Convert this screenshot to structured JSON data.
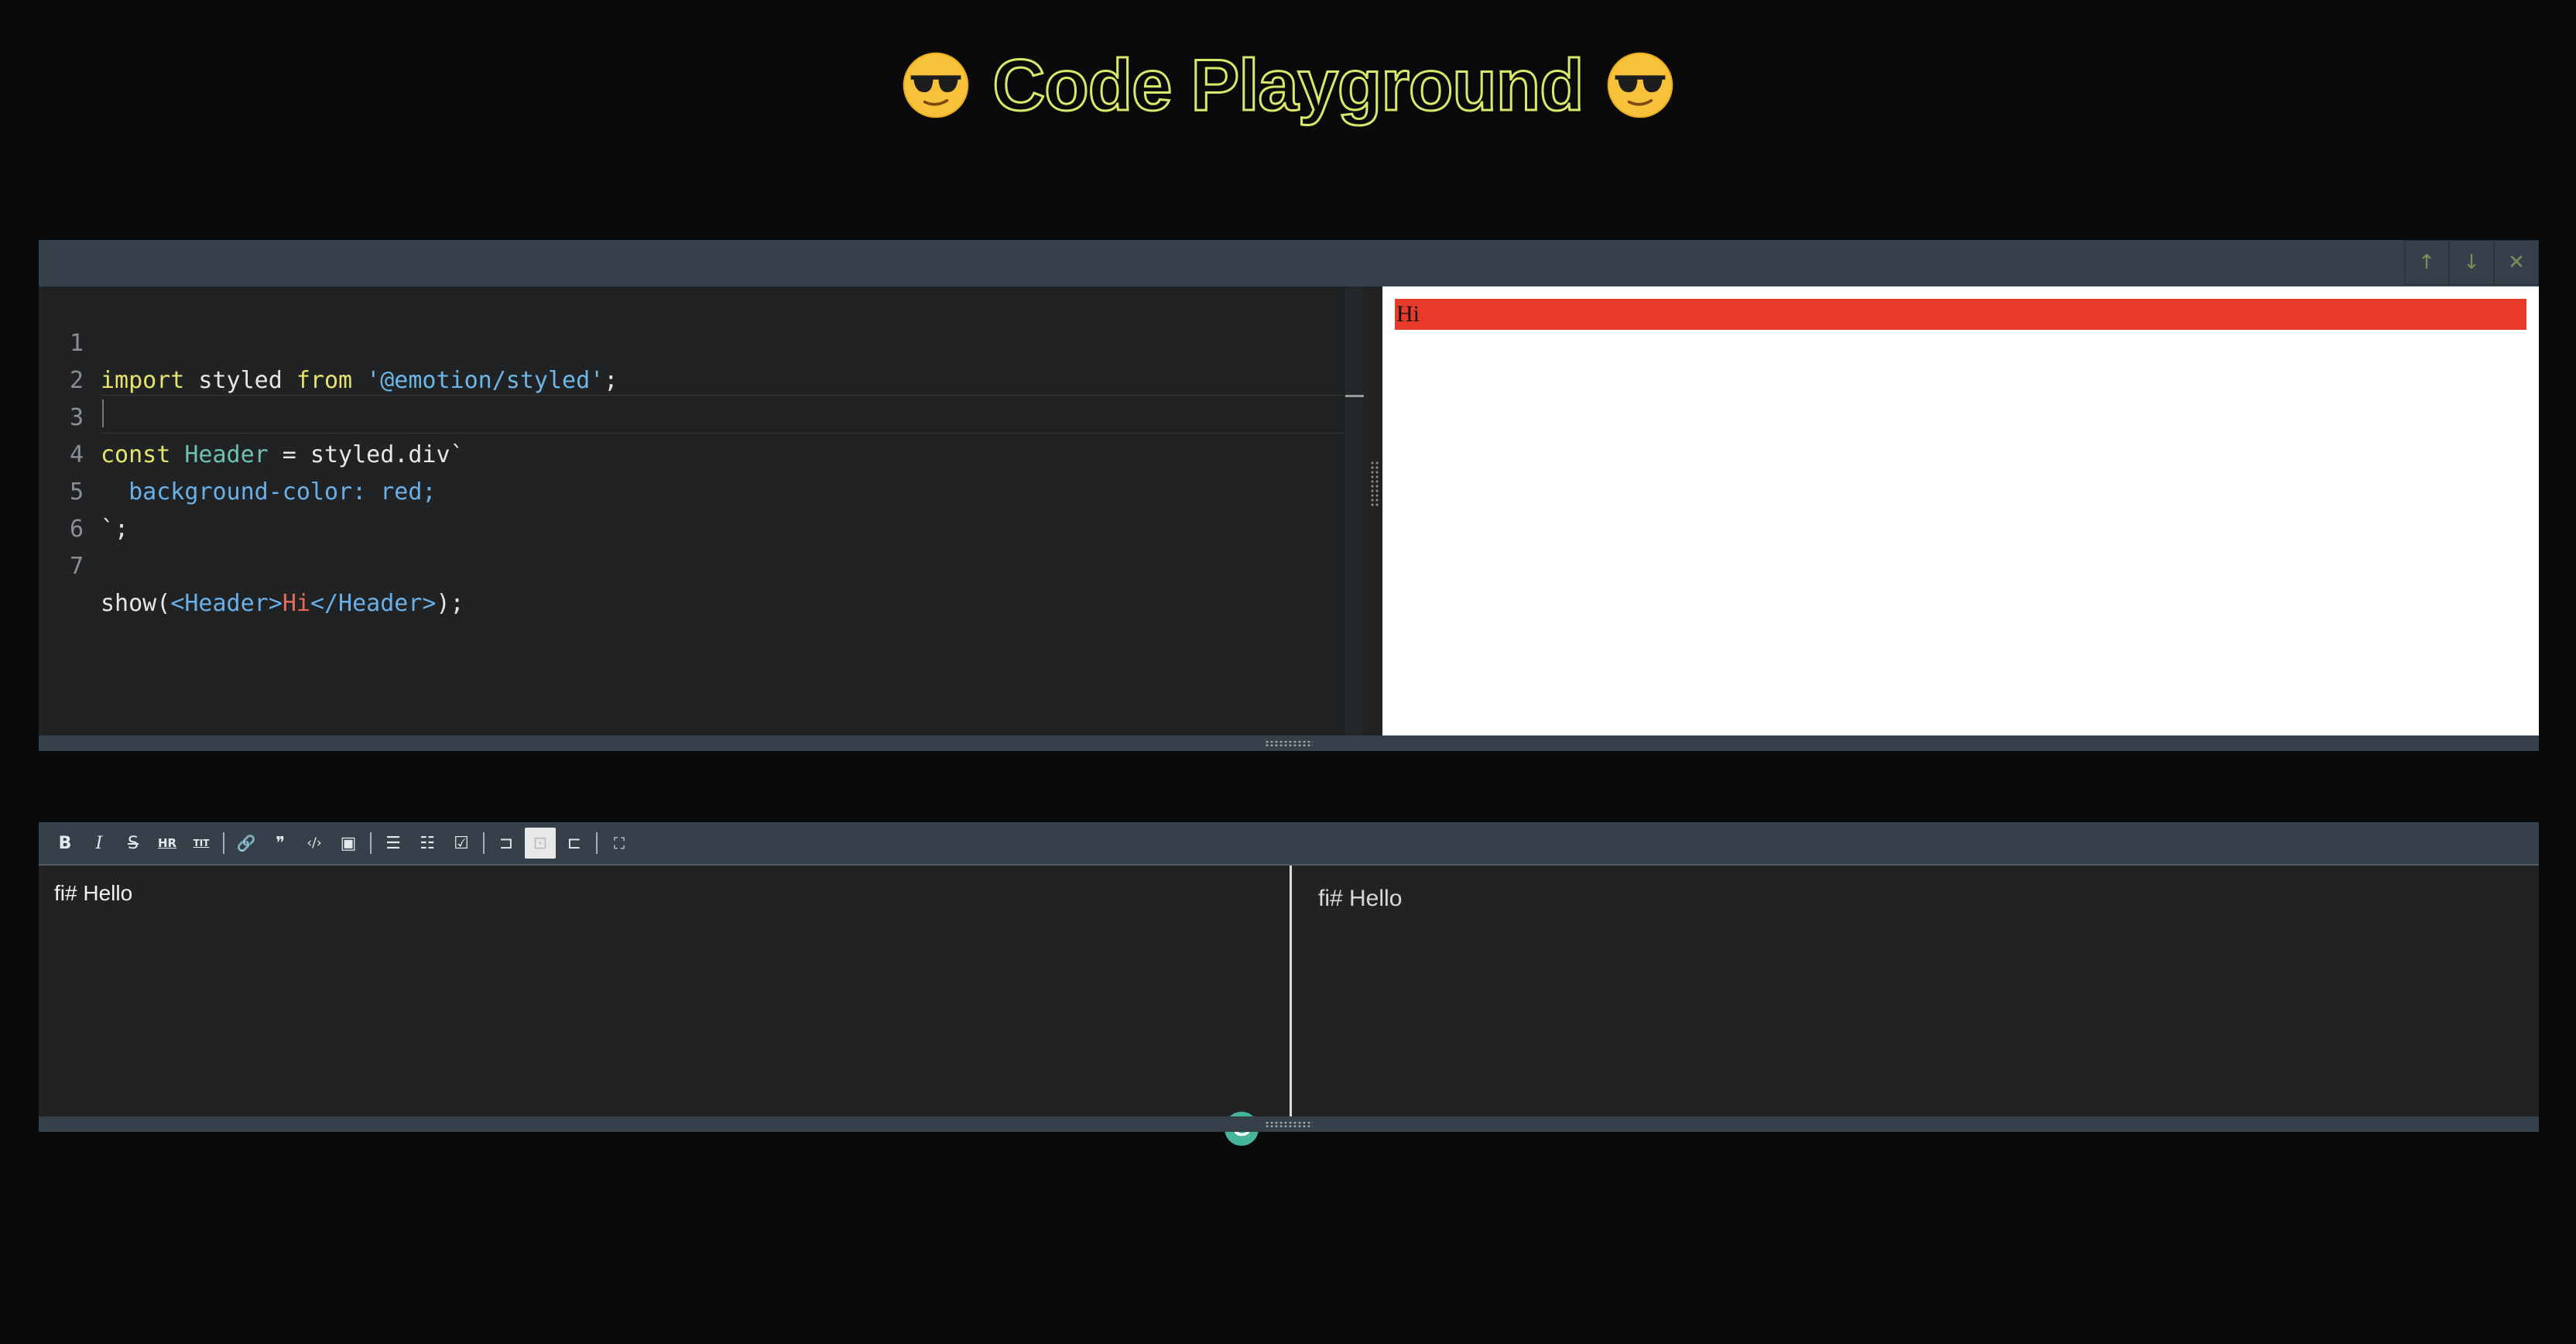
{
  "header": {
    "title": "Code Playground",
    "emoji_left": "sunglasses-face-icon",
    "emoji_right": "sunglasses-face-icon"
  },
  "playground": {
    "toolbar_buttons": [
      {
        "icon": "arrow-up-icon",
        "glyph": "↑"
      },
      {
        "icon": "arrow-down-icon",
        "glyph": "↓"
      },
      {
        "icon": "close-icon",
        "glyph": "✕"
      }
    ],
    "code_lines": [
      {
        "num": "1",
        "text": "import styled from '@emotion/styled';"
      },
      {
        "num": "2",
        "text": ""
      },
      {
        "num": "3",
        "text": "const Header = styled.div`"
      },
      {
        "num": "4",
        "text": "  background-color: red;"
      },
      {
        "num": "5",
        "text": "`;"
      },
      {
        "num": "6",
        "text": ""
      },
      {
        "num": "7",
        "text": "show(<Header>Hi</Header>);"
      }
    ],
    "preview_text": "Hi"
  },
  "markdown": {
    "toolbar": [
      {
        "name": "bold",
        "glyph": "B"
      },
      {
        "name": "italic",
        "glyph": "I"
      },
      {
        "name": "strikethrough",
        "glyph": "S"
      },
      {
        "name": "hr",
        "glyph": "HR"
      },
      {
        "name": "title",
        "glyph": "TIT"
      },
      {
        "name": "link",
        "glyph": "🔗"
      },
      {
        "name": "quote",
        "glyph": "❞"
      },
      {
        "name": "code",
        "glyph": "‹/›"
      },
      {
        "name": "image",
        "glyph": "▣"
      },
      {
        "name": "unordered-list",
        "glyph": "☰"
      },
      {
        "name": "ordered-list",
        "glyph": "☷"
      },
      {
        "name": "task-list",
        "glyph": "☑"
      },
      {
        "name": "toggle-editor",
        "glyph": "⊐"
      },
      {
        "name": "toggle-split",
        "glyph": "⊡"
      },
      {
        "name": "toggle-preview",
        "glyph": "⊏"
      },
      {
        "name": "fullscreen",
        "glyph": "⛶"
      }
    ],
    "source_text": "fi# Hello",
    "preview_text": "fi# Hello",
    "grammarly_label": "G"
  },
  "colors": {
    "title_outline": "#d9e86a",
    "preview_header_bg": "#e83a2a",
    "toolbar_bg": "#35404a"
  }
}
